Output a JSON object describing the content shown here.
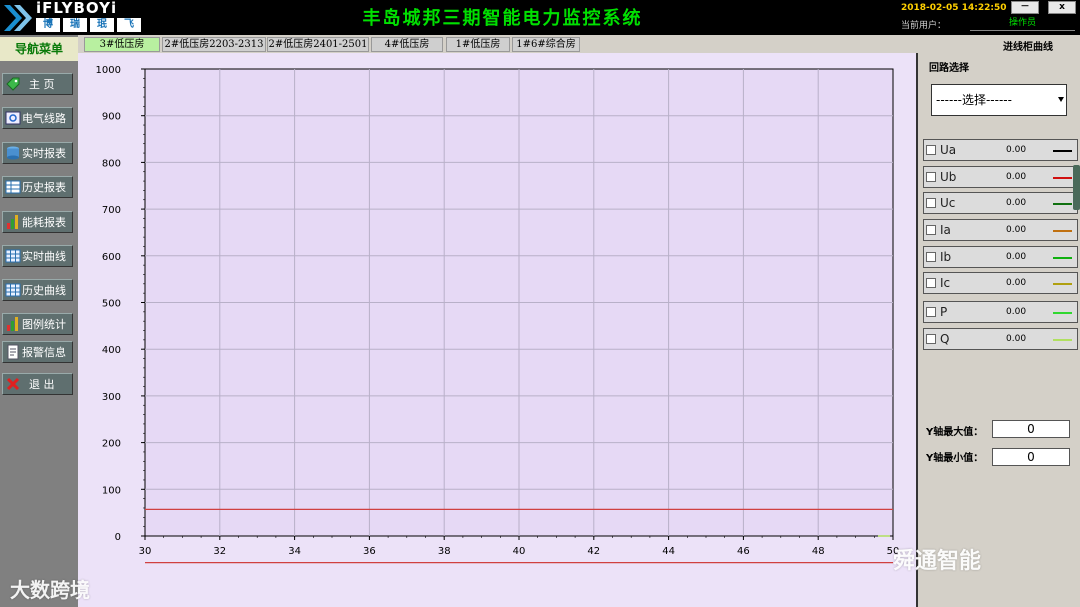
{
  "header": {
    "brand": "iFLYBOYi",
    "brand_cn": [
      "博",
      "瑞",
      "珉",
      "飞"
    ],
    "title": "丰岛城邦三期智能电力监控系统",
    "datetime": "2018-02-05 14:22:50",
    "user_label": "当前用户：",
    "user_value": "操作员",
    "minimize_label": "－",
    "close_label": "x"
  },
  "sidebar": {
    "title": "导航菜单",
    "items": [
      {
        "label": "主 页",
        "icon": "tag-icon"
      },
      {
        "label": "电气线路",
        "icon": "diagram-icon"
      },
      {
        "label": "实时报表",
        "icon": "database-icon"
      },
      {
        "label": "历史报表",
        "icon": "table-icon"
      },
      {
        "label": "能耗报表",
        "icon": "bar-chart-icon"
      },
      {
        "label": "实时曲线",
        "icon": "grid-icon"
      },
      {
        "label": "历史曲线",
        "icon": "grid-icon"
      },
      {
        "label": "图例统计",
        "icon": "bar-chart-icon"
      },
      {
        "label": "报警信息",
        "icon": "document-icon"
      },
      {
        "label": "退 出",
        "icon": "close-x-icon"
      }
    ]
  },
  "tabs": [
    {
      "label": "3#低压房",
      "active": true
    },
    {
      "label": "2#低压房2203-2313",
      "active": false
    },
    {
      "label": "2#低压房2401-2501",
      "active": false
    },
    {
      "label": "4#低压房",
      "active": false
    },
    {
      "label": "1#低压房",
      "active": false
    },
    {
      "label": "1#6#综合房",
      "active": false
    }
  ],
  "page_heading": "进线柜曲线",
  "right_panel": {
    "loop_label": "回路选择",
    "loop_select": "------选择------",
    "series": [
      {
        "name": "Ua",
        "value": "0.00",
        "color": "#000000"
      },
      {
        "name": "Ub",
        "value": "0.00",
        "color": "#d01010"
      },
      {
        "name": "Uc",
        "value": "0.00",
        "color": "#107010"
      },
      {
        "name": "Ia",
        "value": "0.00",
        "color": "#c07010"
      },
      {
        "name": "Ib",
        "value": "0.00",
        "color": "#10b010"
      },
      {
        "name": "Ic",
        "value": "0.00",
        "color": "#b0a010"
      },
      {
        "name": "P",
        "value": "0.00",
        "color": "#30d830"
      },
      {
        "name": "Q",
        "value": "0.00",
        "color": "#b0e060"
      }
    ],
    "ymax_label": "Y轴最大值：",
    "ymax_value": "0",
    "ymin_label": "Y轴最小值：",
    "ymin_value": "0"
  },
  "watermarks": {
    "left": "大数跨境",
    "right": "舜通智能"
  },
  "chart_data": {
    "type": "line",
    "x_ticks": [
      "30",
      "32",
      "34",
      "36",
      "38",
      "40",
      "42",
      "44",
      "46",
      "48",
      "50"
    ],
    "y_ticks": [
      "0",
      "100",
      "200",
      "300",
      "400",
      "500",
      "600",
      "700",
      "800",
      "900",
      "1000"
    ],
    "xlim": [
      30,
      50
    ],
    "ylim": [
      0,
      1000
    ],
    "grid": true,
    "hlines": [
      {
        "y": 57,
        "color": "#d04040"
      },
      {
        "y": -57,
        "color": "#d04040"
      }
    ],
    "series": []
  }
}
